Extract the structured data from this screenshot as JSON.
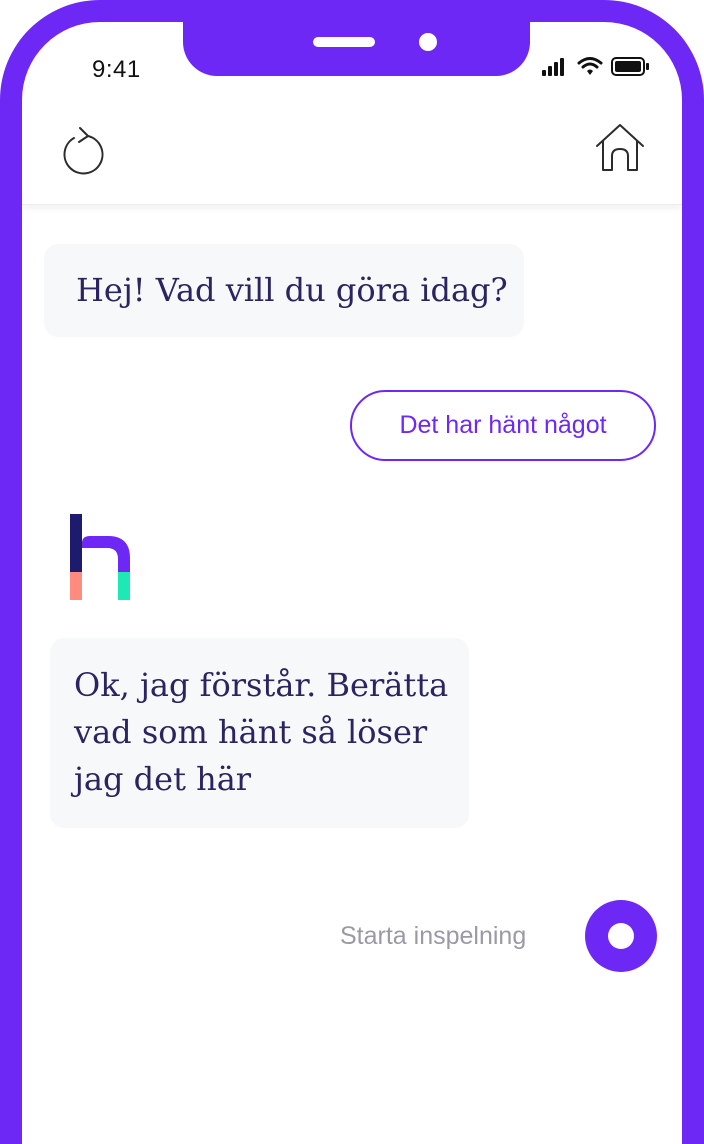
{
  "status_bar": {
    "time": "9:41",
    "signal_icon": "cellular-signal-icon",
    "wifi_icon": "wifi-icon",
    "battery_icon": "battery-icon"
  },
  "header": {
    "restart_icon": "refresh-icon",
    "home_icon": "home-icon"
  },
  "chat": {
    "greeting": "Hej! Vad vill du göra idag?",
    "user_reply": "Det har hänt något",
    "assistant_logo": "brand-logo-h",
    "assistant_message": "Ok, jag förstår. Berätta vad som hänt så löser jag det här"
  },
  "recording": {
    "label": "Starta inspelning"
  },
  "colors": {
    "brand_purple": "#6d28f5",
    "logo_navy": "#1c1b6e",
    "logo_salmon": "#ff8a80",
    "logo_mint": "#1de9b6",
    "bubble_text": "#2a2560",
    "bubble_bg": "#f7f8fa"
  }
}
